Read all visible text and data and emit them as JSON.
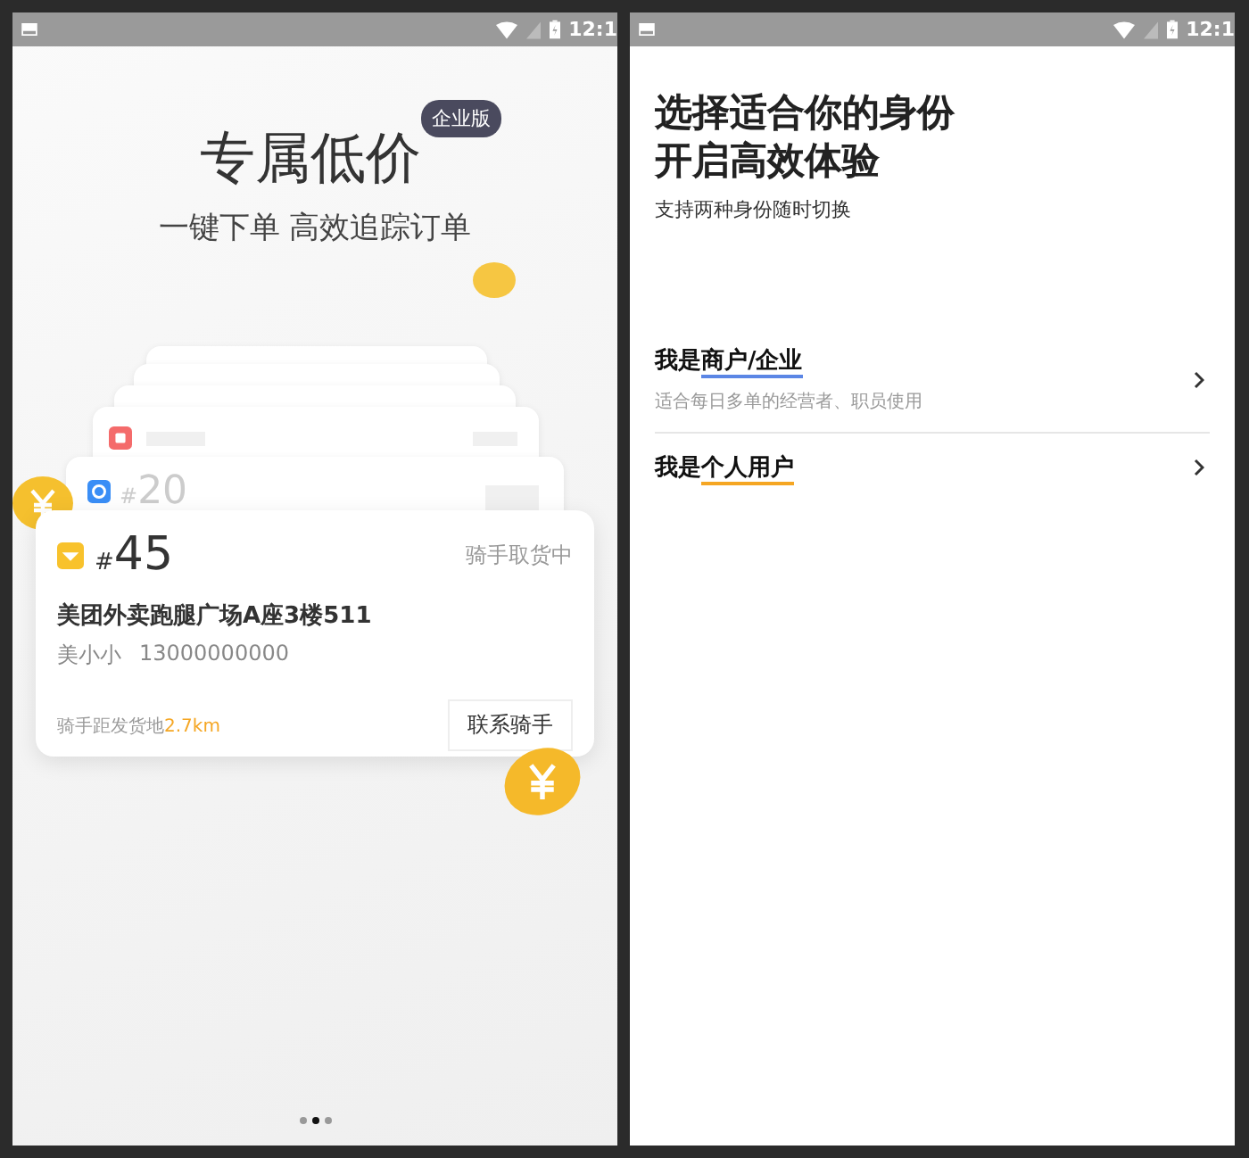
{
  "onboarding": {
    "status_bar": {
      "time": "12:1"
    },
    "badge": "企业版",
    "title": "专属低价",
    "subtitle": "一键下单 高效追踪订单",
    "back_card": {
      "hash": "#",
      "number": "20"
    },
    "order_card": {
      "hash": "#",
      "number": "45",
      "status": "骑手取货中",
      "address": "美团外卖跑腿广场A座3楼511",
      "contact_name": "美小小",
      "phone": "13000000000",
      "distance_label": "骑手距发货地",
      "distance": "2.7km",
      "button": "联系骑手"
    },
    "page_dots": [
      {
        "selected": false
      },
      {
        "selected": true
      },
      {
        "selected": false
      }
    ]
  },
  "identity": {
    "status_bar": {
      "time": "12:1"
    },
    "title_lines": [
      "选择适合你的身份",
      "开启高效体验"
    ],
    "subtitle": "支持两种身份随时切换",
    "options": [
      {
        "prefix": "我是",
        "highlight": "商户/企业",
        "color": "#5b86e5",
        "description": "适合每日多单的经营者、职员使用"
      },
      {
        "prefix": "我是",
        "highlight": "个人用户",
        "color": "#f5a623"
      }
    ]
  }
}
